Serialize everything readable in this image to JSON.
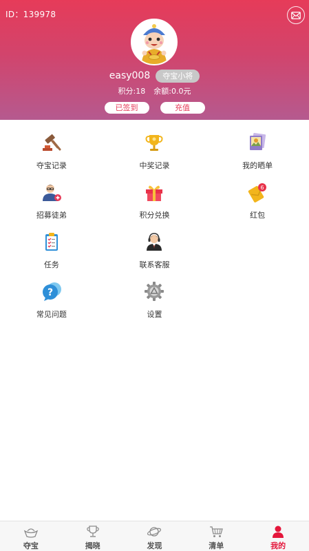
{
  "header": {
    "user_id": "ID：139978",
    "message_icon": "mail-icon",
    "avatar_icon": "cartoon-character-avatar",
    "username": "easy008",
    "level_badge": "夺宝小将",
    "points": "积分:18",
    "balance": "余额:0.0元",
    "signin_label": "已签到",
    "recharge_label": "充值",
    "colors": {
      "gradient_top": "#e63b59",
      "gradient_bottom": "#b55a8f",
      "accent": "#e63b59"
    }
  },
  "menu": [
    {
      "label": "夺宝记录",
      "icon": "gavel-icon"
    },
    {
      "label": "中奖记录",
      "icon": "trophy-icon"
    },
    {
      "label": "我的晒单",
      "icon": "photo-icon"
    },
    {
      "label": "招募徒弟",
      "icon": "recruit-user-icon"
    },
    {
      "label": "积分兑换",
      "icon": "gift-icon"
    },
    {
      "label": "红包",
      "icon": "red-envelope-icon"
    },
    {
      "label": "任务",
      "icon": "clipboard-icon"
    },
    {
      "label": "联系客服",
      "icon": "customer-service-icon"
    },
    {
      "label": "常见问题",
      "icon": "question-bubble-icon"
    },
    {
      "label": "设置",
      "icon": "settings-gear-icon"
    }
  ],
  "bottom_nav": {
    "items": [
      {
        "label": "夺宝",
        "icon": "ingot-icon"
      },
      {
        "label": "揭晓",
        "icon": "trophy-outline-icon"
      },
      {
        "label": "发现",
        "icon": "planet-icon"
      },
      {
        "label": "清单",
        "icon": "cart-icon"
      },
      {
        "label": "我的",
        "icon": "person-icon"
      }
    ],
    "active_index": 4,
    "active_color": "#e4163b"
  }
}
